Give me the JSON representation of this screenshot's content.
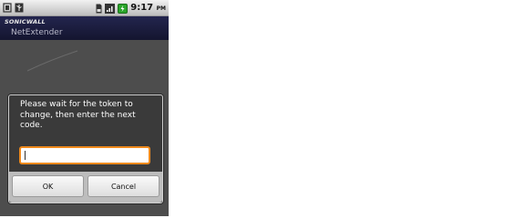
{
  "status_bar": {
    "icons": [
      "usb-debug-icon",
      "usb-icon",
      "sd-card-icon",
      "signal-icon",
      "battery-charging-icon"
    ],
    "time": "9:17",
    "ampm": "PM"
  },
  "app_header": {
    "brand": "SONICWALL",
    "title": "NetExtender"
  },
  "dialog": {
    "message": "Please wait for the token to change, then enter the next code.",
    "input_value": "",
    "ok_label": "OK",
    "cancel_label": "Cancel"
  },
  "colors": {
    "header_bg": "#1c1d3e",
    "input_focus": "#f08a1c",
    "dialog_bg": "#3a3a3a",
    "button_bar_bg": "#bdbdbd"
  }
}
